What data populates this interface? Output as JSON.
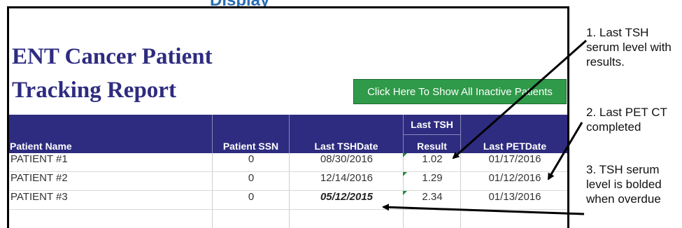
{
  "cut_title": "Display",
  "report": {
    "title_line1": "ENT Cancer Patient",
    "title_line2": "Tracking Report",
    "show_inactive_label": "Click Here To Show All Inactive Patients"
  },
  "table": {
    "headers": {
      "name": "Patient Name",
      "ssn": "Patient SSN",
      "tsh_date": "Last TSHDate",
      "tsh_result_line1": "Last TSH",
      "tsh_result_line2": "Result",
      "pet_date": "Last PETDate"
    },
    "rows": [
      {
        "name": "PATIENT #1",
        "ssn": "0",
        "tsh_date": "08/30/2016",
        "tsh_result": "1.02",
        "pet_date": "01/17/2016",
        "overdue": false
      },
      {
        "name": "PATIENT #2",
        "ssn": "0",
        "tsh_date": "12/14/2016",
        "tsh_result": "1.29",
        "pet_date": "01/12/2016",
        "overdue": false
      },
      {
        "name": "PATIENT #3",
        "ssn": "0",
        "tsh_date": "05/12/2015",
        "tsh_result": "2.34",
        "pet_date": "01/13/2016",
        "overdue": true
      }
    ]
  },
  "annotations": [
    {
      "label": "1. Last TSH serum level with results."
    },
    {
      "label": "2. Last PET CT completed"
    },
    {
      "label": "3. TSH serum level is bolded when overdue"
    }
  ],
  "colors": {
    "header_bg": "#2e2c80",
    "title_text": "#2e2c80",
    "button_bg": "#2f9a49"
  }
}
